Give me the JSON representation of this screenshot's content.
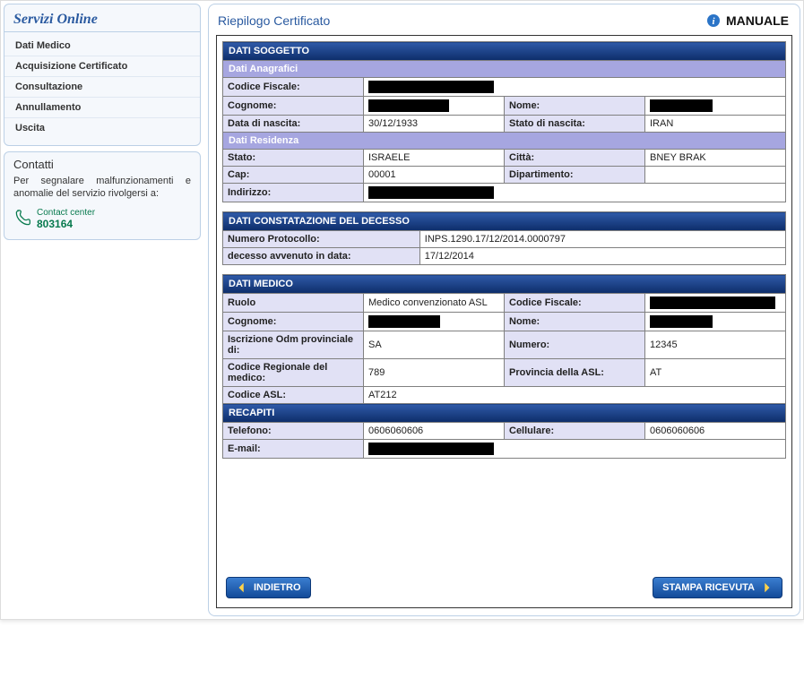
{
  "sidebar": {
    "title": "Servizi Online",
    "items": [
      {
        "label": "Dati Medico"
      },
      {
        "label": "Acquisizione Certificato"
      },
      {
        "label": "Consultazione"
      },
      {
        "label": "Annullamento"
      },
      {
        "label": "Uscita"
      }
    ],
    "contacts": {
      "title": "Contatti",
      "text": "Per segnalare malfunzionamenti e anomalie del servizio rivolgersi a:",
      "cc_label": "Contact center",
      "cc_number": "803164"
    }
  },
  "panel": {
    "title": "Riepilogo Certificato",
    "manual_label": "MANUALE"
  },
  "soggetto": {
    "header": "DATI SOGGETTO",
    "sub_anag": "Dati Anagrafici",
    "cf_label": "Codice Fiscale:",
    "cognome_label": "Cognome:",
    "nome_label": "Nome:",
    "data_nascita_label": "Data di nascita:",
    "data_nascita_value": "30/12/1933",
    "stato_nascita_label": "Stato di nascita:",
    "stato_nascita_value": "IRAN",
    "sub_res": "Dati Residenza",
    "stato_label": "Stato:",
    "stato_value": "ISRAELE",
    "citta_label": "Città:",
    "citta_value": "BNEY BRAK",
    "cap_label": "Cap:",
    "cap_value": "00001",
    "dipartimento_label": "Dipartimento:",
    "dipartimento_value": "",
    "indirizzo_label": "Indirizzo:"
  },
  "decesso": {
    "header": "DATI CONSTATAZIONE DEL DECESSO",
    "protocollo_label": "Numero Protocollo:",
    "protocollo_value": "INPS.1290.17/12/2014.0000797",
    "data_label": "decesso avvenuto in data:",
    "data_value": "17/12/2014"
  },
  "medico": {
    "header": "DATI MEDICO",
    "ruolo_label": "Ruolo",
    "ruolo_value": "Medico convenzionato ASL",
    "cf_label": "Codice Fiscale:",
    "cognome_label": "Cognome:",
    "nome_label": "Nome:",
    "iscr_label": "Iscrizione Odm provinciale di:",
    "iscr_value": "SA",
    "numero_label": "Numero:",
    "numero_value": "12345",
    "codreg_label": "Codice Regionale del medico:",
    "codreg_value": "789",
    "provasl_label": "Provincia della ASL:",
    "provasl_value": "AT",
    "codasl_label": "Codice ASL:",
    "codasl_value": "AT212"
  },
  "recapiti": {
    "header": "RECAPITI",
    "tel_label": "Telefono:",
    "tel_value": "0606060606",
    "cell_label": "Cellulare:",
    "cell_value": "0606060606",
    "email_label": "E-mail:"
  },
  "buttons": {
    "back": "INDIETRO",
    "print": "STAMPA RICEVUTA"
  }
}
